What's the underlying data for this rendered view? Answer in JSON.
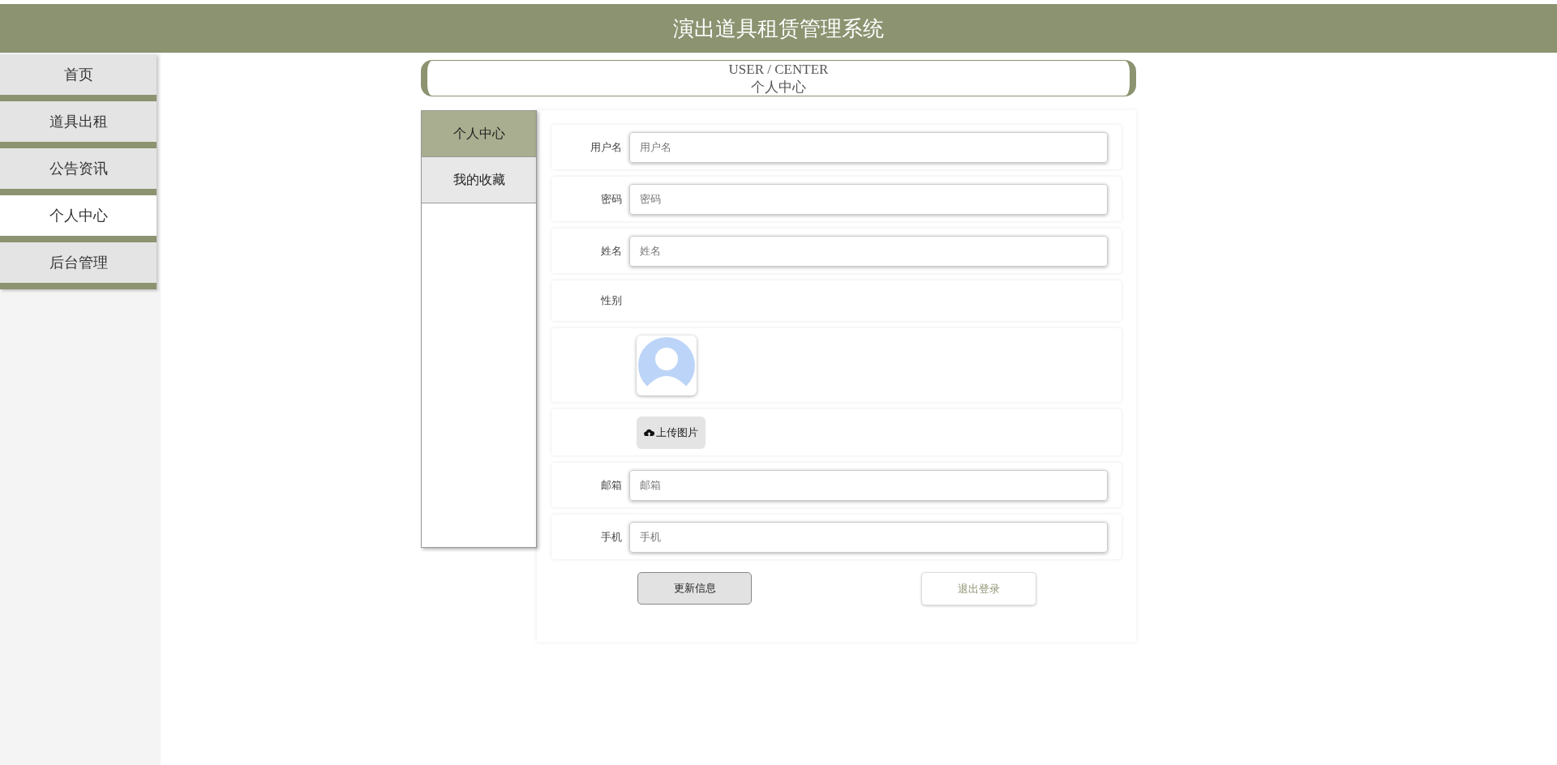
{
  "header": {
    "title": "演出道具租赁管理系统"
  },
  "nav": [
    {
      "label": "首页",
      "selected": false
    },
    {
      "label": "道具出租",
      "selected": false
    },
    {
      "label": "公告资讯",
      "selected": false
    },
    {
      "label": "个人中心",
      "selected": true
    },
    {
      "label": "后台管理",
      "selected": false
    }
  ],
  "page_title": {
    "english": "USER / CENTER",
    "chinese": "个人中心"
  },
  "side_tabs": [
    {
      "label": "个人中心",
      "selected": true
    },
    {
      "label": "我的收藏",
      "selected": false
    }
  ],
  "form": [
    {
      "kind": "input",
      "label": "用户名",
      "placeholder": "用户名"
    },
    {
      "kind": "input",
      "label": "密码",
      "placeholder": "密码"
    },
    {
      "kind": "input",
      "label": "姓名",
      "placeholder": "姓名"
    },
    {
      "kind": "empty",
      "label": "性别"
    },
    {
      "kind": "avatar"
    },
    {
      "kind": "upload",
      "button": "上传图片"
    },
    {
      "kind": "input",
      "label": "邮箱",
      "placeholder": "邮箱"
    },
    {
      "kind": "input",
      "label": "手机",
      "placeholder": "手机"
    }
  ],
  "buttons": {
    "update": "更新信息",
    "logout": "退出登录"
  }
}
